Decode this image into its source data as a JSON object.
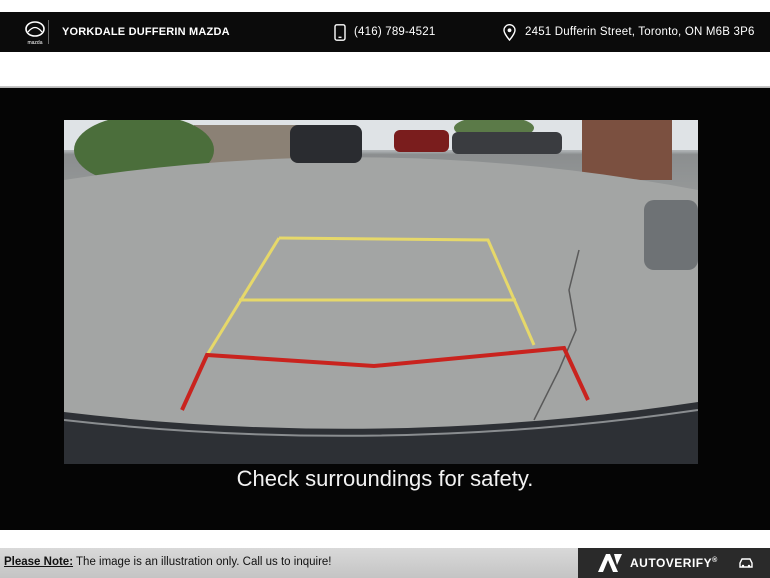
{
  "header": {
    "dealer_name": "YORKDALE DUFFERIN MAZDA",
    "phone": "(416) 789-4521",
    "address": "2451 Dufferin Street, Toronto, ON M6B 3P6",
    "logo_icon": "mazda-logo-icon",
    "phone_icon": "phone-icon",
    "location_icon": "location-pin-icon"
  },
  "screen": {
    "caption": "Check surroundings for safety.",
    "guide_colors": {
      "far": "#e6d86a",
      "near": "#c9231e"
    }
  },
  "footer": {
    "note_label": "Please Note:",
    "note_text": " The image is an illustration only. Call us to inquire!",
    "brand": "AUTOVERIFY",
    "brand_mark": "®"
  }
}
